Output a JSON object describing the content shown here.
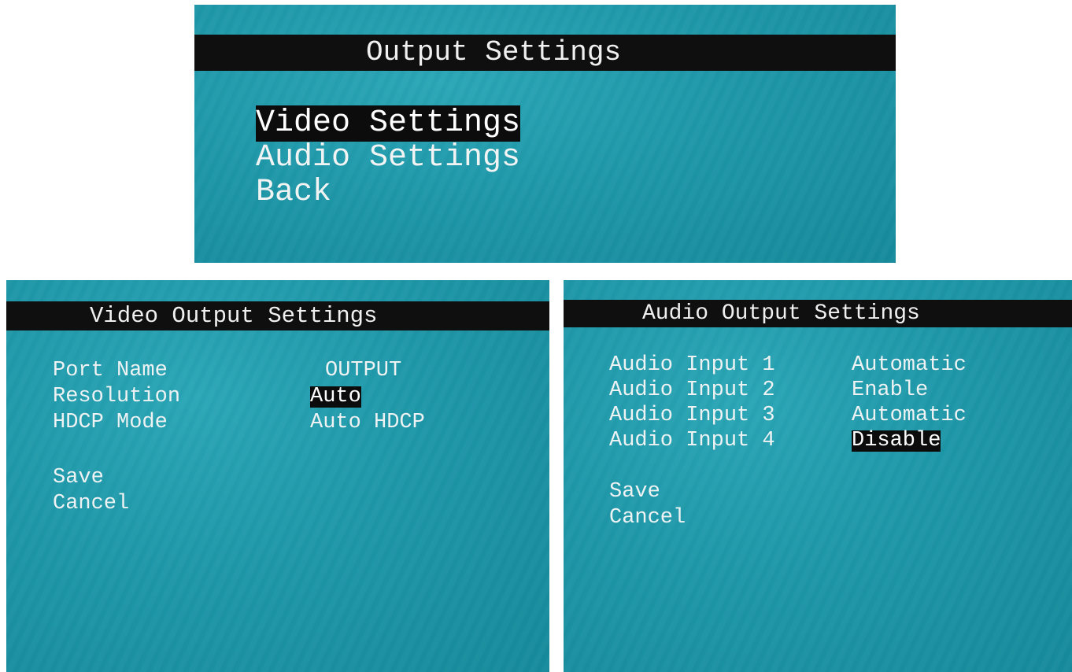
{
  "output_settings": {
    "title": "Output Settings",
    "menu": [
      {
        "label": "Video Settings",
        "selected": true
      },
      {
        "label": "Audio Settings",
        "selected": false
      },
      {
        "label": "Back",
        "selected": false
      }
    ]
  },
  "video_output_settings": {
    "title": "Video Output Settings",
    "rows": [
      {
        "label": "Port Name",
        "value": "OUTPUT",
        "selected": false
      },
      {
        "label": "Resolution",
        "value": "Auto",
        "selected": true
      },
      {
        "label": "HDCP Mode",
        "value": "Auto HDCP",
        "selected": false
      }
    ],
    "save_label": "Save",
    "cancel_label": "Cancel"
  },
  "audio_output_settings": {
    "title": "Audio Output Settings",
    "rows": [
      {
        "label": "Audio Input 1",
        "value": "Automatic",
        "selected": false
      },
      {
        "label": "Audio Input 2",
        "value": "Enable",
        "selected": false
      },
      {
        "label": "Audio Input 3",
        "value": "Automatic",
        "selected": false
      },
      {
        "label": "Audio Input 4",
        "value": "Disable",
        "selected": true
      }
    ],
    "save_label": "Save",
    "cancel_label": "Cancel"
  },
  "colors": {
    "screen_background": "#1e97a8",
    "title_bar": "#0f0f0f",
    "highlight": "#0c0c0c",
    "text": "#eef2f2"
  }
}
